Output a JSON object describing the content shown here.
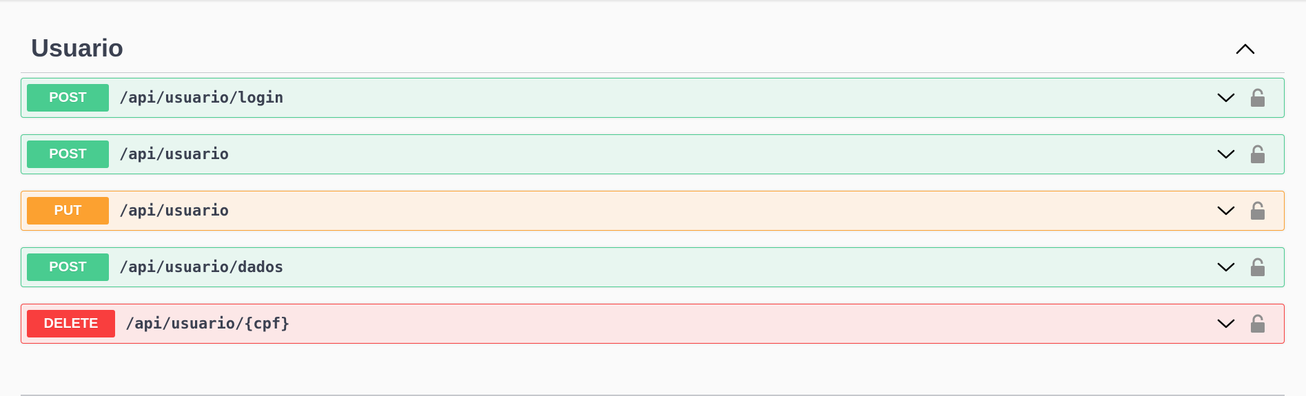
{
  "section": {
    "title": "Usuario",
    "collapse_icon": "chevron-up-icon"
  },
  "operations": [
    {
      "method": "POST",
      "path": "/api/usuario/login",
      "color": "#49cc90"
    },
    {
      "method": "POST",
      "path": "/api/usuario",
      "color": "#49cc90"
    },
    {
      "method": "PUT",
      "path": "/api/usuario",
      "color": "#fca130"
    },
    {
      "method": "POST",
      "path": "/api/usuario/dados",
      "color": "#49cc90"
    },
    {
      "method": "DELETE",
      "path": "/api/usuario/{cpf}",
      "color": "#f93e3e"
    }
  ],
  "icons": {
    "expand": "chevron-down-icon",
    "auth": "unlocked-padlock-icon"
  }
}
